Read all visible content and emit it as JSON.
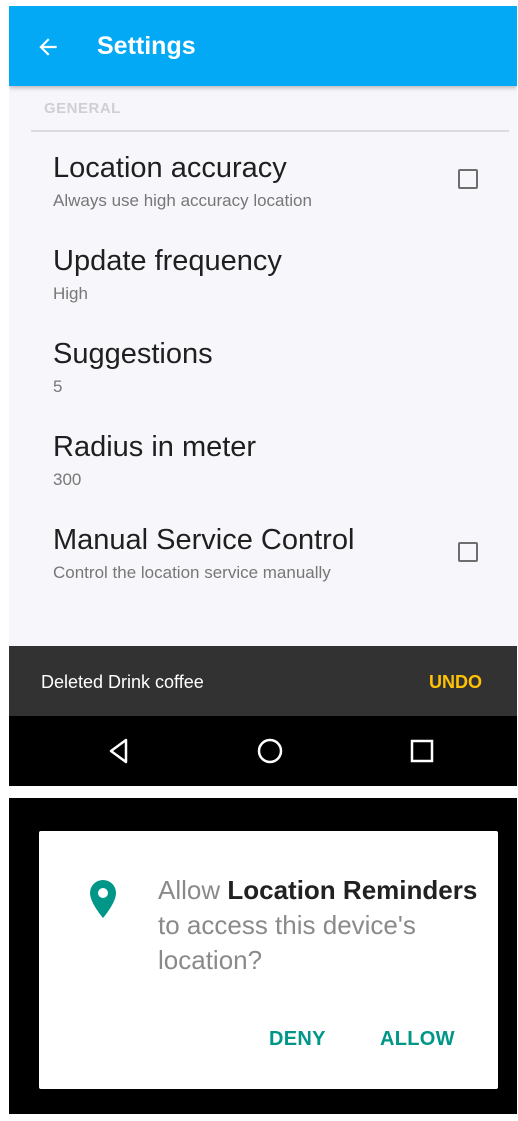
{
  "settings": {
    "appbar": {
      "title": "Settings",
      "back_icon": "arrow-left-icon",
      "color": "#03a9f4"
    },
    "section_header": "GENERAL",
    "preferences": [
      {
        "title": "Location accuracy",
        "summary": "Always use high accuracy location",
        "checkbox": true,
        "checked": false
      },
      {
        "title": "Update frequency",
        "summary": "High"
      },
      {
        "title": "Suggestions",
        "summary": "5"
      },
      {
        "title": "Radius in meter",
        "summary": "300"
      },
      {
        "title": "Manual Service Control",
        "summary": "Control the location service manually",
        "checkbox": true,
        "checked": false
      }
    ]
  },
  "snackbar": {
    "message": "Deleted Drink coffee",
    "action": "UNDO",
    "action_color": "#ffc107"
  },
  "navbar": {
    "icons": [
      "back-triangle-icon",
      "home-circle-icon",
      "recents-square-icon"
    ]
  },
  "permission_dialog": {
    "icon": "location-pin-icon",
    "prefix": "Allow ",
    "app_name": "Location Reminders",
    "suffix": " to access this device's location?",
    "deny_label": "DENY",
    "allow_label": "ALLOW",
    "accent_color": "#009688"
  }
}
